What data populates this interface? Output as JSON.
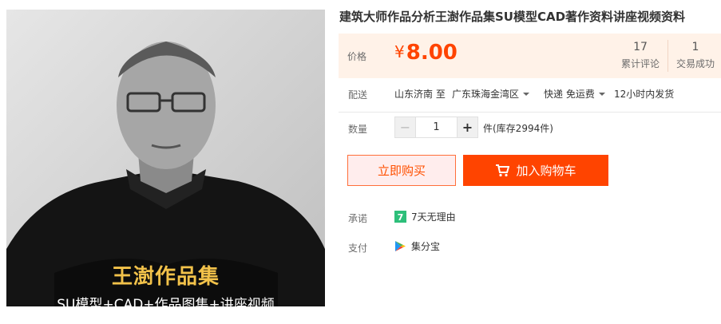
{
  "product": {
    "title": "建筑大师作品分析王澍作品集SU模型CAD著作资料讲座视频资料",
    "image": {
      "overlay_title": "王澍作品集",
      "overlay_subtitle": "SU模型+CAD+作品图集+讲座视频"
    }
  },
  "price": {
    "label": "价格",
    "currency": "¥",
    "value": "8.00",
    "reviews_count": "17",
    "reviews_label": "累计评论",
    "sales_count": "1",
    "sales_label": "交易成功",
    "accent_color": "#ff4400"
  },
  "shipping": {
    "label": "配送",
    "from": "山东济南 至",
    "to": "广东珠海金湾区",
    "method": "快递 免运费",
    "dispatch": "12小时内发货"
  },
  "quantity": {
    "label": "数量",
    "minus": "−",
    "value": "1",
    "plus": "+",
    "stock": "件(库存2994件)"
  },
  "actions": {
    "buy_now": "立即购买",
    "add_to_cart": "加入购物车"
  },
  "promise": {
    "label": "承诺",
    "badge": "7",
    "text": "7天无理由"
  },
  "payment": {
    "label": "支付",
    "icon": "play-store-icon",
    "text": "集分宝"
  }
}
